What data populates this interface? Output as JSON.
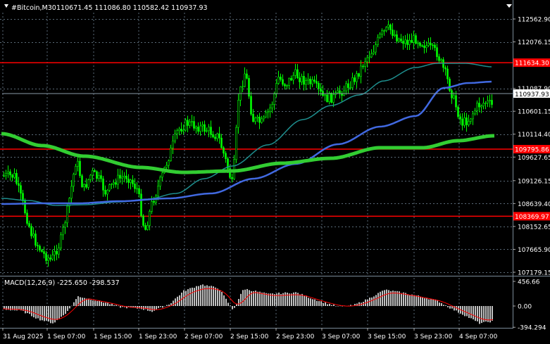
{
  "header": {
    "symbol": "#Bitcoin,M30",
    "ohlc": "110671.45 111086.80 110582.42 110937.93"
  },
  "price_axis": {
    "ticks": [
      "112562.90",
      "112076.15",
      "111087.90",
      "110601.15",
      "110114.40",
      "109627.65",
      "109126.15",
      "108639.40",
      "108152.65",
      "107665.90",
      "107179.15"
    ],
    "current_price": "110937.93"
  },
  "levels": [
    {
      "label": "111634.30",
      "price": 111634.3
    },
    {
      "label": "109795.86",
      "price": 109795.86
    },
    {
      "label": "108369.97",
      "price": 108369.97
    }
  ],
  "macd": {
    "label": "MACD(12,26,9) -225.650 -298.537",
    "ticks": [
      "456.66",
      "0.00",
      "-394.294"
    ]
  },
  "time_axis": {
    "ticks": [
      "31 Aug 2025",
      "1 Sep 07:00",
      "1 Sep 15:00",
      "1 Sep 23:00",
      "2 Sep 07:00",
      "2 Sep 15:00",
      "2 Sep 23:00",
      "3 Sep 07:00",
      "3 Sep 15:00",
      "3 Sep 23:00",
      "4 Sep 07:00"
    ]
  },
  "colors": {
    "background": "#000000",
    "candle": "#00ff00",
    "grid": "#5a6a78",
    "level_line": "#ff0000",
    "ma_thin": "#1e8e8e",
    "ma_mid": "#4169e1",
    "ma_thick": "#32cd32",
    "macd_hist": "#c0c0c0",
    "macd_signal": "#ff0000",
    "axis_text": "#ffffff"
  }
}
